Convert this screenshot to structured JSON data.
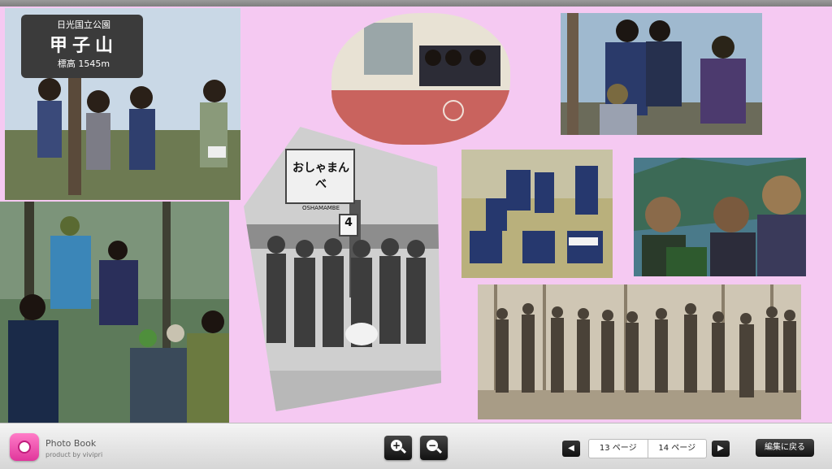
{
  "app": {
    "brand_title": "Photo Book",
    "brand_sub": "product by vivipri"
  },
  "photos": {
    "sign_koshi_line1": "日光国立公園",
    "sign_koshi_line2": "甲子山",
    "sign_koshi_line3": "標高 1545m",
    "sign_station_name": "おしゃまんべ",
    "sign_station_sub": "OSHAMAMBE",
    "sign_station_num": "4"
  },
  "toolbar": {
    "zoom_in_label": "+",
    "zoom_out_label": "−",
    "prev_arrow": "◀",
    "next_arrow": "▶",
    "page_left": "13 ページ",
    "page_right": "14 ページ",
    "back_label": "編集に戻る"
  }
}
